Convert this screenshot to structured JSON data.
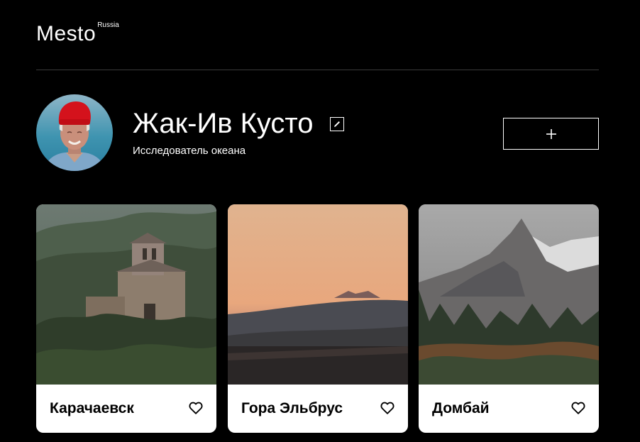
{
  "header": {
    "logo_main": "Mesto",
    "logo_sub": "Russia"
  },
  "profile": {
    "name": "Жак-Ив Кусто",
    "about": "Исследователь океана",
    "add_button_label": "+"
  },
  "cards": [
    {
      "title": "Карачаевск"
    },
    {
      "title": "Гора Эльбрус"
    },
    {
      "title": "Домбай"
    }
  ],
  "colors": {
    "background": "#000000",
    "text": "#ffffff",
    "card_background": "#ffffff",
    "card_text": "#000000"
  }
}
